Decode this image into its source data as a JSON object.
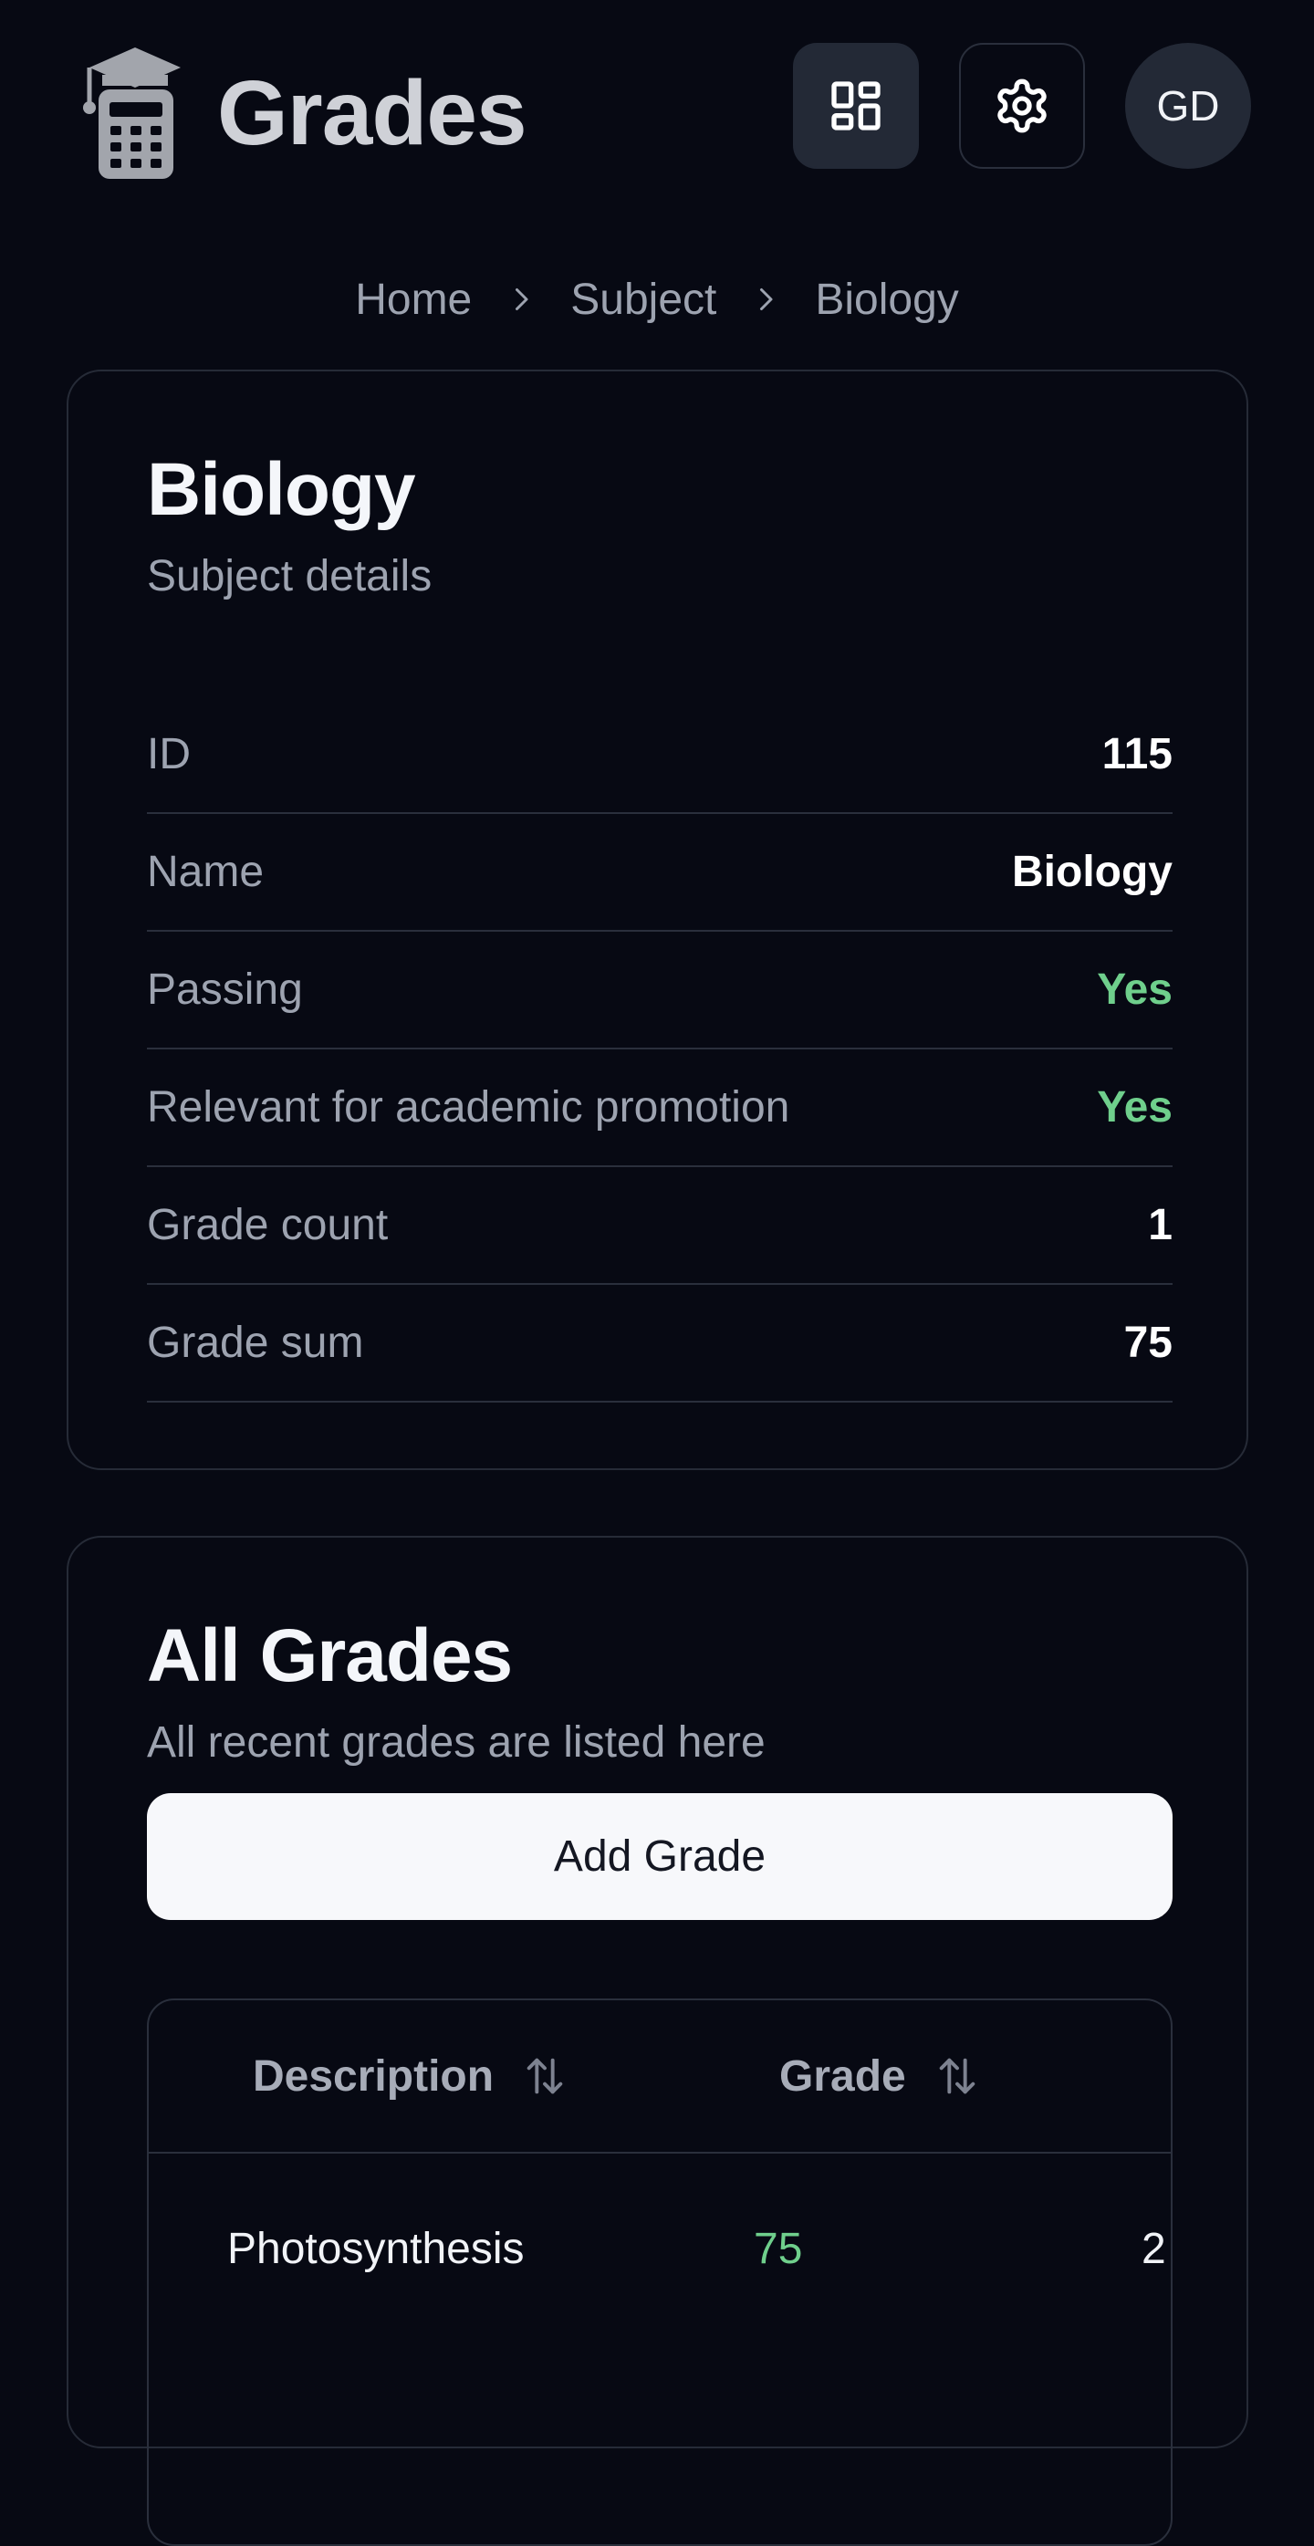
{
  "header": {
    "title": "Grades",
    "avatar_initials": "GD",
    "icons": {
      "logo": "graduation-calculator-icon",
      "dashboard": "dashboard-grid-icon",
      "settings": "gear-icon"
    }
  },
  "breadcrumb": {
    "items": [
      "Home",
      "Subject",
      "Biology"
    ]
  },
  "details": {
    "title": "Biology",
    "subtitle": "Subject details",
    "rows": [
      {
        "label": "ID",
        "value": "115"
      },
      {
        "label": "Name",
        "value": "Biology"
      },
      {
        "label": "Passing",
        "value": "Yes"
      },
      {
        "label": "Relevant for academic promotion",
        "value": "Yes"
      },
      {
        "label": "Grade count",
        "value": "1"
      },
      {
        "label": "Grade sum",
        "value": "75"
      }
    ]
  },
  "grades": {
    "title": "All Grades",
    "subtitle": "All recent grades are listed here",
    "add_button": "Add Grade",
    "columns": [
      "Description",
      "Grade"
    ],
    "rows": [
      {
        "description": "Photosynthesis",
        "grade": "75",
        "extra": "2"
      }
    ]
  },
  "colors": {
    "background": "#070913",
    "positive": "#6fcf8c",
    "muted_text": "#9da3b0",
    "border": "#2a2f3c"
  }
}
